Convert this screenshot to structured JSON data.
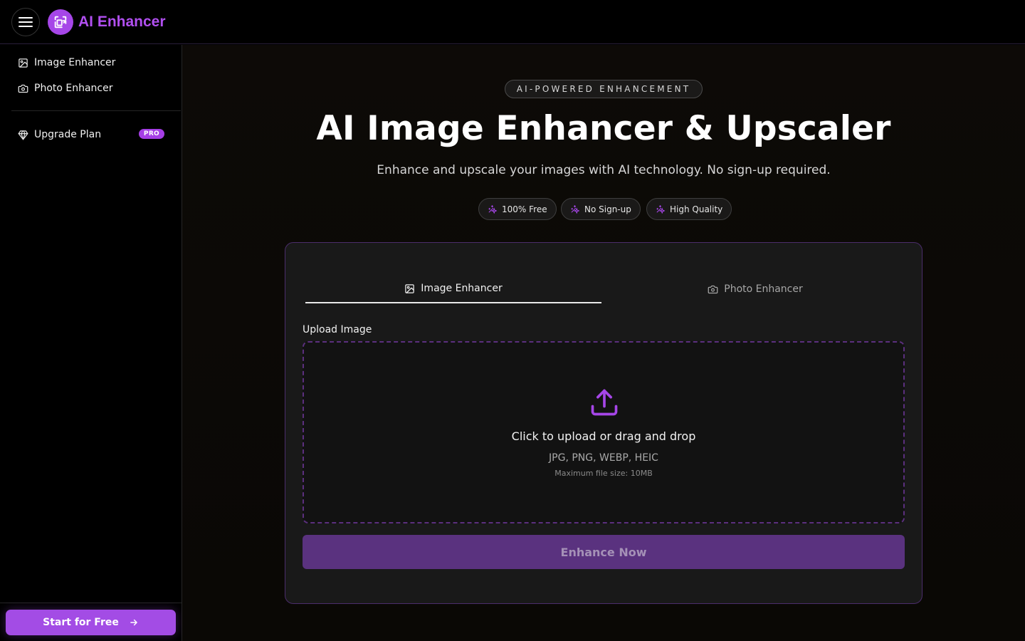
{
  "header": {
    "brand": "AI Enhancer",
    "menu_icon": "hamburger-menu-icon",
    "logo_icon": "enhance-logo-icon"
  },
  "sidebar": {
    "items": [
      {
        "label": "Image Enhancer",
        "icon": "image-icon"
      },
      {
        "label": "Photo Enhancer",
        "icon": "camera-icon"
      },
      {
        "label": "Upgrade Plan",
        "icon": "diamond-icon",
        "badge": "PRO"
      }
    ],
    "cta": "Start for Free"
  },
  "hero": {
    "pill": "AI-POWERED ENHANCEMENT",
    "title": "AI Image Enhancer & Upscaler",
    "subtitle": "Enhance and upscale your images with AI technology. No sign-up required.",
    "features": [
      "100% Free",
      "No Sign-up",
      "High Quality"
    ]
  },
  "card": {
    "tabs": [
      {
        "label": "Image Enhancer",
        "icon": "image-icon",
        "active": true
      },
      {
        "label": "Photo Enhancer",
        "icon": "camera-icon",
        "active": false
      }
    ],
    "upload_label": "Upload Image",
    "dropzone": {
      "main": "Click to upload or drag and drop",
      "types": "JPG, PNG, WEBP, HEIC",
      "max": "Maximum file size: 10MB"
    },
    "button": "Enhance Now"
  },
  "colors": {
    "accent": "#a646e8",
    "brand_text": "#b14ff0",
    "button_disabled": "#5a327f"
  }
}
